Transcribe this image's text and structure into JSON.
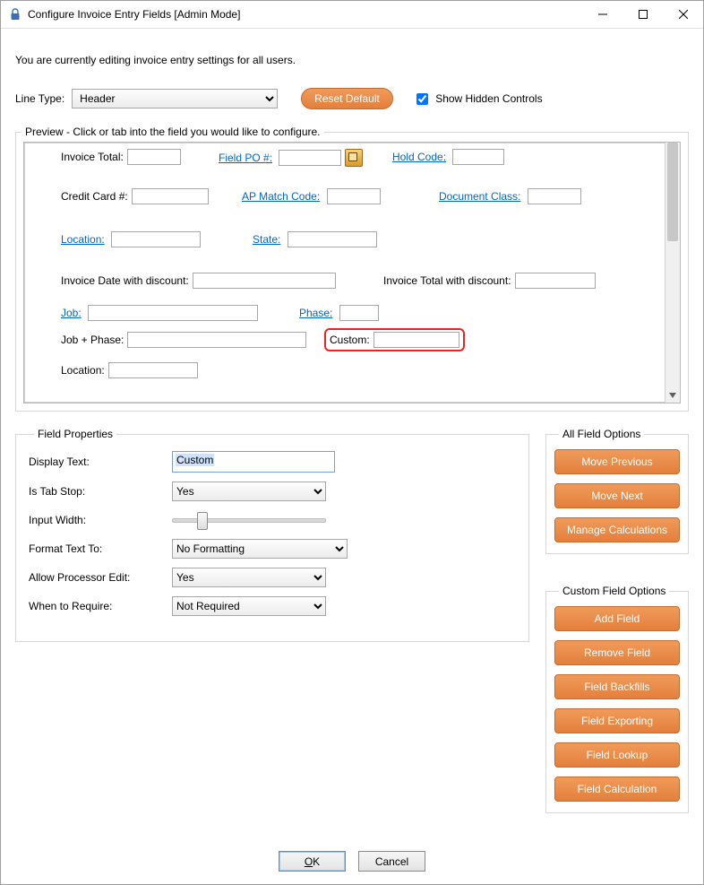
{
  "window": {
    "title": "Configure Invoice Entry Fields [Admin Mode]"
  },
  "intro": "You are currently editing invoice entry settings for all users.",
  "lineType": {
    "label": "Line Type:",
    "value": "Header"
  },
  "resetDefault": "Reset Default",
  "showHidden": {
    "label": "Show Hidden Controls",
    "checked": true
  },
  "preview": {
    "legend": "Preview - Click or tab into the field you would like to configure.",
    "fields": {
      "invoiceTotal": "Invoice Total:",
      "fieldPO": "Field PO #:",
      "holdCode": "Hold Code:",
      "creditCard": "Credit Card #:",
      "apMatch": "AP Match Code:",
      "docClass": "Document Class:",
      "location": "Location:",
      "state": "State:",
      "invDateDisc": "Invoice Date with discount:",
      "invTotalDisc": "Invoice Total with discount:",
      "job": "Job:",
      "phase": "Phase:",
      "jobPhase": "Job + Phase:",
      "custom": "Custom:",
      "location2": "Location:"
    }
  },
  "fieldProps": {
    "legend": "Field Properties",
    "displayText": {
      "label": "Display Text:",
      "value": "Custom"
    },
    "tabStop": {
      "label": "Is Tab Stop:",
      "value": "Yes"
    },
    "inputWidth": {
      "label": "Input Width:"
    },
    "formatText": {
      "label": "Format Text To:",
      "value": "No Formatting"
    },
    "allowProc": {
      "label": "Allow Processor Edit:",
      "value": "Yes"
    },
    "whenRequire": {
      "label": "When to Require:",
      "value": "Not Required"
    }
  },
  "allFieldOptions": {
    "legend": "All Field Options",
    "movePrev": "Move Previous",
    "moveNext": "Move Next",
    "manageCalc": "Manage Calculations"
  },
  "customFieldOptions": {
    "legend": "Custom Field Options",
    "addField": "Add Field",
    "removeField": "Remove Field",
    "fieldBackfills": "Field Backfills",
    "fieldExporting": "Field Exporting",
    "fieldLookup": "Field Lookup",
    "fieldCalc": "Field Calculation"
  },
  "footer": {
    "ok": "OK",
    "cancel": "Cancel"
  }
}
